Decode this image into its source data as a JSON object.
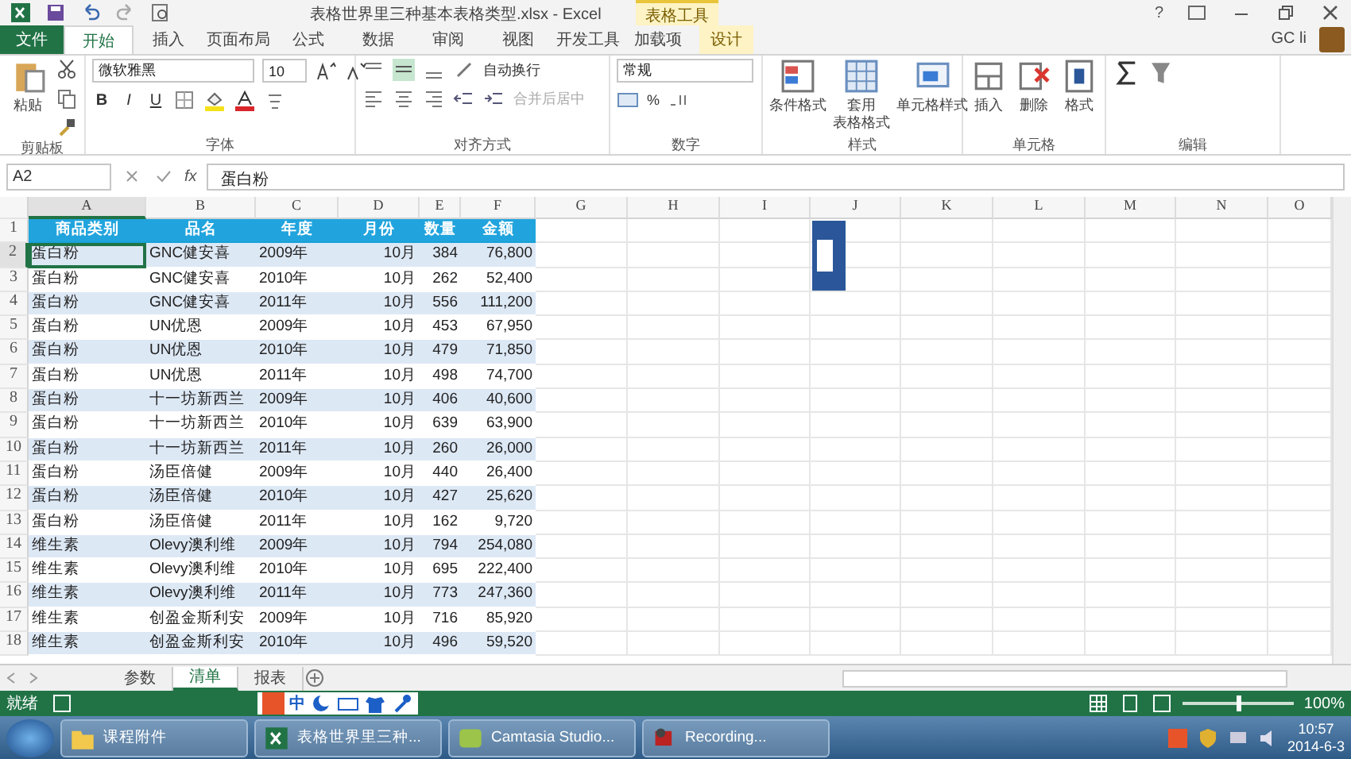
{
  "title_bar": {
    "title": "表格世界里三种基本表格类型.xlsx - Excel",
    "context_tab": "表格工具",
    "help": "?",
    "user": "GC li"
  },
  "tabs": [
    {
      "label": "文件",
      "kind": "file",
      "selected": false
    },
    {
      "label": "开始",
      "kind": "tab",
      "selected": true
    },
    {
      "label": "插入",
      "kind": "tab",
      "selected": false
    },
    {
      "label": "页面布局",
      "kind": "tab",
      "selected": false
    },
    {
      "label": "公式",
      "kind": "tab",
      "selected": false
    },
    {
      "label": "数据",
      "kind": "tab",
      "selected": false
    },
    {
      "label": "审阅",
      "kind": "tab",
      "selected": false
    },
    {
      "label": "视图",
      "kind": "tab",
      "selected": false
    },
    {
      "label": "开发工具",
      "kind": "tab",
      "selected": false
    },
    {
      "label": "加载项",
      "kind": "tab",
      "selected": false
    },
    {
      "label": "设计",
      "kind": "context",
      "selected": false
    }
  ],
  "ribbon": {
    "clipboard": {
      "label": "剪贴板",
      "paste": "粘贴"
    },
    "font": {
      "label": "字体",
      "font_name": "微软雅黑",
      "font_size": "10",
      "style_buttons": [
        "B",
        "I",
        "U"
      ]
    },
    "alignment": {
      "label": "对齐方式",
      "wrap_text": {
        "label": "自动换行",
        "disabled": false
      },
      "merge": {
        "label": "合并后居中",
        "disabled": true
      }
    },
    "number": {
      "label": "数字",
      "format": "常规",
      "percent": "%"
    },
    "styles": {
      "label": "样式",
      "buttons": [
        {
          "kind": "conditional",
          "label": "条件格式"
        },
        {
          "kind": "table",
          "label": "套用",
          "label_2": "表格格式"
        },
        {
          "kind": "cellstyle",
          "label": "单元格样式"
        }
      ]
    },
    "cells": {
      "label": "单元格",
      "buttons": [
        {
          "kind": "insert",
          "label": "插入"
        },
        {
          "kind": "delete",
          "label": "删除"
        },
        {
          "kind": "format",
          "label": "格式"
        }
      ]
    },
    "editing": {
      "label": "编辑"
    }
  },
  "formula_bar": {
    "name_box": "A2",
    "function_label": "fx",
    "value": "蛋白粉"
  },
  "sheet": {
    "columns": [
      {
        "label": "A",
        "selected": true
      },
      {
        "label": "B",
        "selected": false
      },
      {
        "label": "C",
        "selected": false
      },
      {
        "label": "D",
        "selected": false
      },
      {
        "label": "E",
        "selected": false
      },
      {
        "label": "F",
        "selected": false
      },
      {
        "label": "G",
        "selected": false
      },
      {
        "label": "H",
        "selected": false
      },
      {
        "label": "I",
        "selected": false
      },
      {
        "label": "J",
        "selected": false
      },
      {
        "label": "K",
        "selected": false
      },
      {
        "label": "L",
        "selected": false
      },
      {
        "label": "M",
        "selected": false
      },
      {
        "label": "N",
        "selected": false
      },
      {
        "label": "O",
        "selected": false
      }
    ],
    "header_row": {
      "num": "1",
      "cells": [
        "商品类别",
        "品名",
        "年度",
        "月份",
        "数量",
        "金额"
      ]
    },
    "rows": [
      {
        "num": "2",
        "selected": true,
        "cells": [
          "蛋白粉",
          "GNC健安喜",
          "2009年",
          "10月",
          "384",
          "76,800"
        ]
      },
      {
        "num": "3",
        "selected": false,
        "cells": [
          "蛋白粉",
          "GNC健安喜",
          "2010年",
          "10月",
          "262",
          "52,400"
        ]
      },
      {
        "num": "4",
        "selected": false,
        "cells": [
          "蛋白粉",
          "GNC健安喜",
          "2011年",
          "10月",
          "556",
          "111,200"
        ]
      },
      {
        "num": "5",
        "selected": false,
        "cells": [
          "蛋白粉",
          "UN优恩",
          "2009年",
          "10月",
          "453",
          "67,950"
        ]
      },
      {
        "num": "6",
        "selected": false,
        "cells": [
          "蛋白粉",
          "UN优恩",
          "2010年",
          "10月",
          "479",
          "71,850"
        ]
      },
      {
        "num": "7",
        "selected": false,
        "cells": [
          "蛋白粉",
          "UN优恩",
          "2011年",
          "10月",
          "498",
          "74,700"
        ]
      },
      {
        "num": "8",
        "selected": false,
        "cells": [
          "蛋白粉",
          "十一坊新西兰",
          "2009年",
          "10月",
          "406",
          "40,600"
        ]
      },
      {
        "num": "9",
        "selected": false,
        "cells": [
          "蛋白粉",
          "十一坊新西兰",
          "2010年",
          "10月",
          "639",
          "63,900"
        ]
      },
      {
        "num": "10",
        "selected": false,
        "cells": [
          "蛋白粉",
          "十一坊新西兰",
          "2011年",
          "10月",
          "260",
          "26,000"
        ]
      },
      {
        "num": "11",
        "selected": false,
        "cells": [
          "蛋白粉",
          "汤臣倍健",
          "2009年",
          "10月",
          "440",
          "26,400"
        ]
      },
      {
        "num": "12",
        "selected": false,
        "cells": [
          "蛋白粉",
          "汤臣倍健",
          "2010年",
          "10月",
          "427",
          "25,620"
        ]
      },
      {
        "num": "13",
        "selected": false,
        "cells": [
          "蛋白粉",
          "汤臣倍健",
          "2011年",
          "10月",
          "162",
          "9,720"
        ]
      },
      {
        "num": "14",
        "selected": false,
        "cells": [
          "维生素",
          "Olevy澳利维",
          "2009年",
          "10月",
          "794",
          "254,080"
        ]
      },
      {
        "num": "15",
        "selected": false,
        "cells": [
          "维生素",
          "Olevy澳利维",
          "2010年",
          "10月",
          "695",
          "222,400"
        ]
      },
      {
        "num": "16",
        "selected": false,
        "cells": [
          "维生素",
          "Olevy澳利维",
          "2011年",
          "10月",
          "773",
          "247,360"
        ]
      },
      {
        "num": "17",
        "selected": false,
        "cells": [
          "维生素",
          "创盈金斯利安",
          "2009年",
          "10月",
          "716",
          "85,920"
        ]
      },
      {
        "num": "18",
        "selected": false,
        "cells": [
          "维生素",
          "创盈金斯利安",
          "2010年",
          "10月",
          "496",
          "59,520"
        ]
      }
    ]
  },
  "sheet_tabs": [
    {
      "label": "参数",
      "selected": false
    },
    {
      "label": "清单",
      "selected": true
    },
    {
      "label": "报表",
      "selected": false
    }
  ],
  "status_bar": {
    "status": "就绪",
    "ime": "中",
    "zoom": {
      "level": 0.5,
      "reading": "100%"
    }
  },
  "taskbar": {
    "items": [
      {
        "kind": "folder",
        "label": "课程附件"
      },
      {
        "kind": "excel",
        "label": "表格世界里三种..."
      },
      {
        "kind": "camtasia",
        "label": "Camtasia Studio..."
      },
      {
        "kind": "recorder",
        "label": "Recording..."
      }
    ],
    "time": "10:57",
    "date": "2014-6-3"
  }
}
